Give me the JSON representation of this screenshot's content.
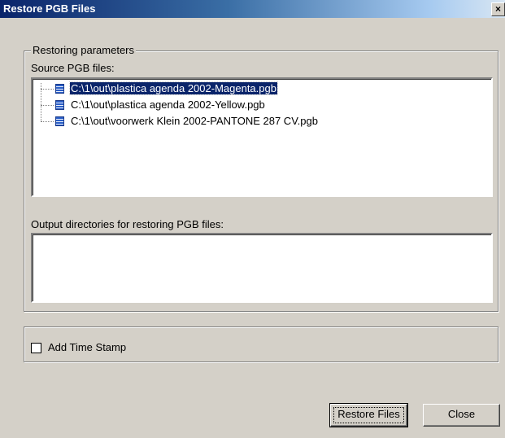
{
  "window": {
    "title": "Restore PGB Files",
    "close_glyph": "×"
  },
  "params_group": {
    "legend": "Restoring parameters",
    "source_label": "Source PGB files:",
    "source_files": [
      {
        "path": "C:\\1\\out\\plastica agenda 2002-Magenta.pgb",
        "selected": true,
        "icon": "pgb-file-icon"
      },
      {
        "path": "C:\\1\\out\\plastica agenda 2002-Yellow.pgb",
        "selected": false,
        "icon": "pgb-file-icon"
      },
      {
        "path": "C:\\1\\out\\voorwerk Klein 2002-PANTONE 287 CV.pgb",
        "selected": false,
        "icon": "pgb-file-icon"
      }
    ],
    "output_label": "Output directories for restoring PGB files:",
    "output_dirs": []
  },
  "options_group": {
    "timestamp_label": "Add Time Stamp",
    "timestamp_checked": false
  },
  "buttons": {
    "restore_label": "Restore Files",
    "close_label": "Close"
  },
  "colors": {
    "face": "#d4d0c8",
    "title_start": "#0a246a",
    "title_end": "#a6caf0",
    "selection": "#0a246a"
  }
}
